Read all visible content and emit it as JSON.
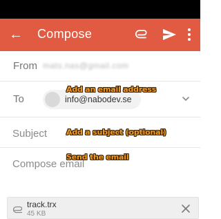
{
  "app_bar": {
    "title": "Compose",
    "color": "#e15a42",
    "icons": [
      "back-arrow-icon",
      "paperclip-icon",
      "send-icon",
      "more-vert-icon"
    ]
  },
  "from": {
    "label": "From",
    "value": "mats.nas@gmail.com"
  },
  "to": {
    "label": "To",
    "recipient": "info@nabodev.se"
  },
  "subject": {
    "placeholder": "Subject"
  },
  "body": {
    "placeholder": "Compose email"
  },
  "annotations": {
    "add_email": "Add an email address",
    "add_subject": "Add a subject (optional)",
    "send_email": "Send the email"
  },
  "attachment": {
    "name": "track.trx",
    "size": "45 KB"
  }
}
